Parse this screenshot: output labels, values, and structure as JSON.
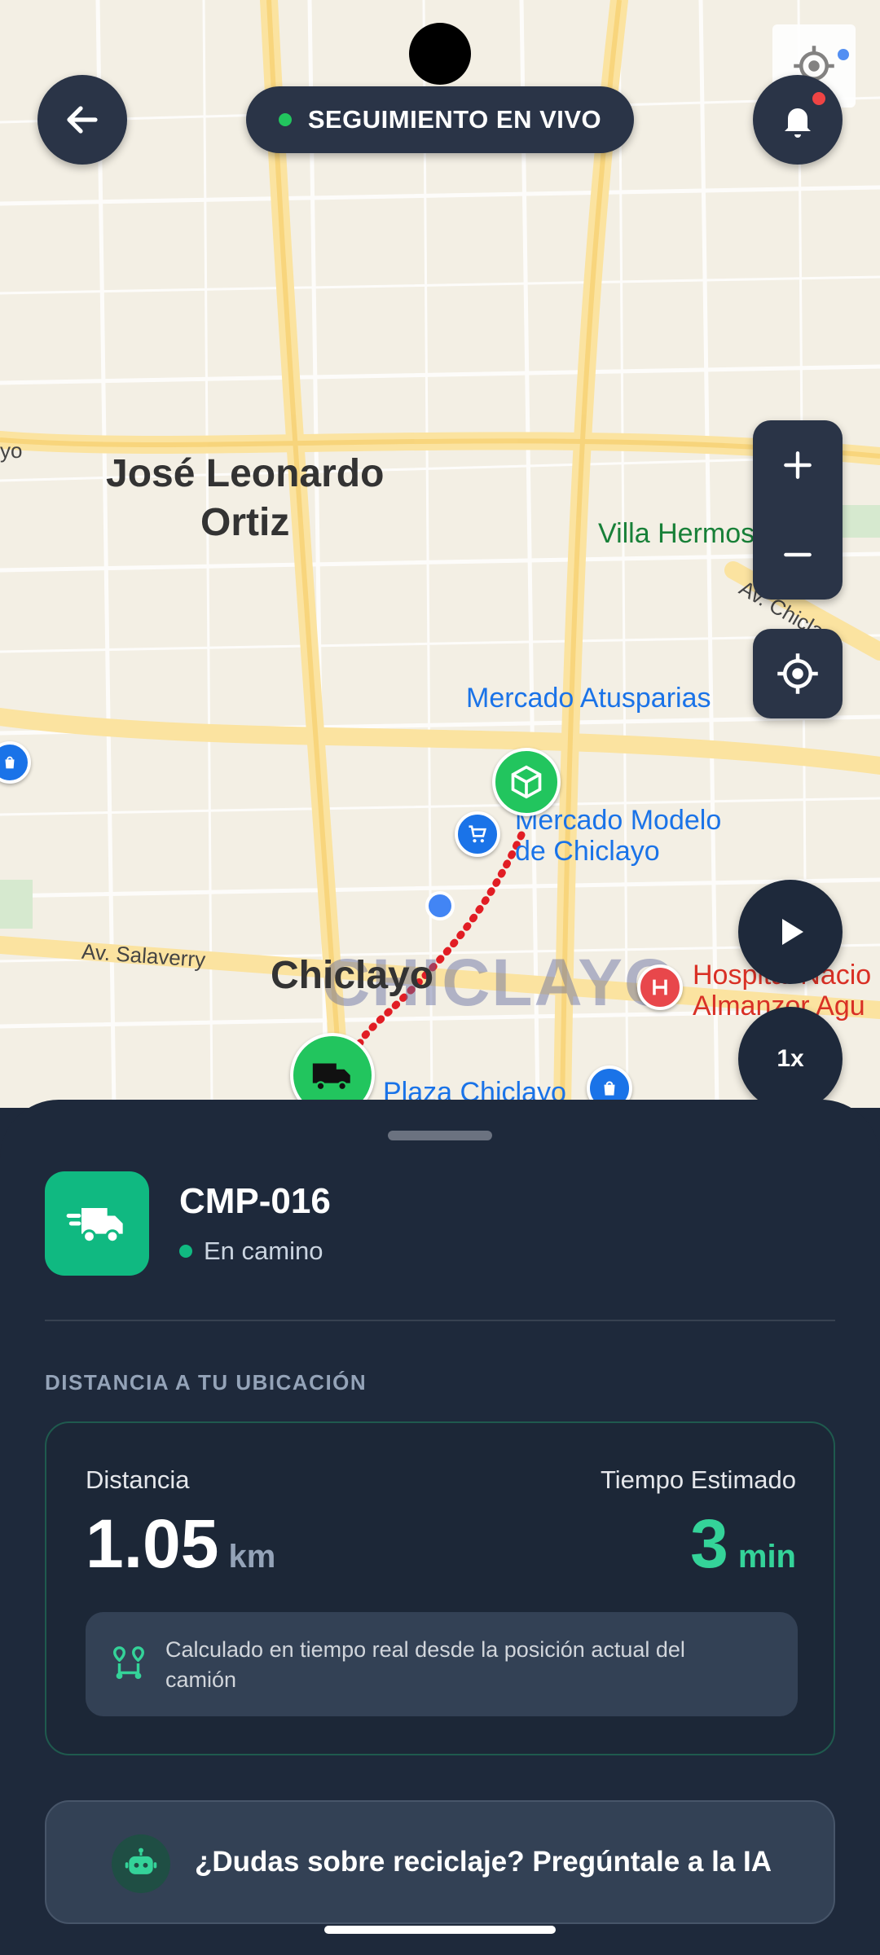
{
  "header": {
    "live_label": "SEGUIMIENTO EN VIVO",
    "back_icon": "arrow-left-icon",
    "bell_icon": "bell-icon"
  },
  "map": {
    "places": {
      "district": "José Leonardo\nOrtiz",
      "villa": "Villa Hermosa",
      "atusparias": "Mercado Atusparias",
      "mercado_modelo": "Mercado Modelo\nde Chiclayo",
      "hospital": "Hospital Nacio\nAlmanzor Agu",
      "chiclayo": "Chiclayo",
      "watermark": "CHICLAYO",
      "plaza": "Plaza Chiclayo",
      "salaverry": "Av. Salaverry",
      "av_chiclayo": "Av. Chiclayo",
      "left_edge": "yo"
    },
    "controls": {
      "zoom_in": "+",
      "zoom_out": "−",
      "speed": "1x"
    }
  },
  "vehicle": {
    "id": "CMP-016",
    "status": "En camino"
  },
  "distance_section": {
    "title": "DISTANCIA A TU UBICACIÓN",
    "distance_label": "Distancia",
    "distance_value": "1.05",
    "distance_unit": "km",
    "time_label": "Tiempo Estimado",
    "time_value": "3",
    "time_unit": "min",
    "note": "Calculado en tiempo real desde la posición actual del camión"
  },
  "ai_prompt": {
    "label": "¿Dudas sobre reciclaje? Pregúntale a la IA"
  },
  "colors": {
    "accent": "#10b981",
    "sheet": "#1e293b",
    "route": "#e11d24",
    "live_dot": "#22c55e"
  }
}
